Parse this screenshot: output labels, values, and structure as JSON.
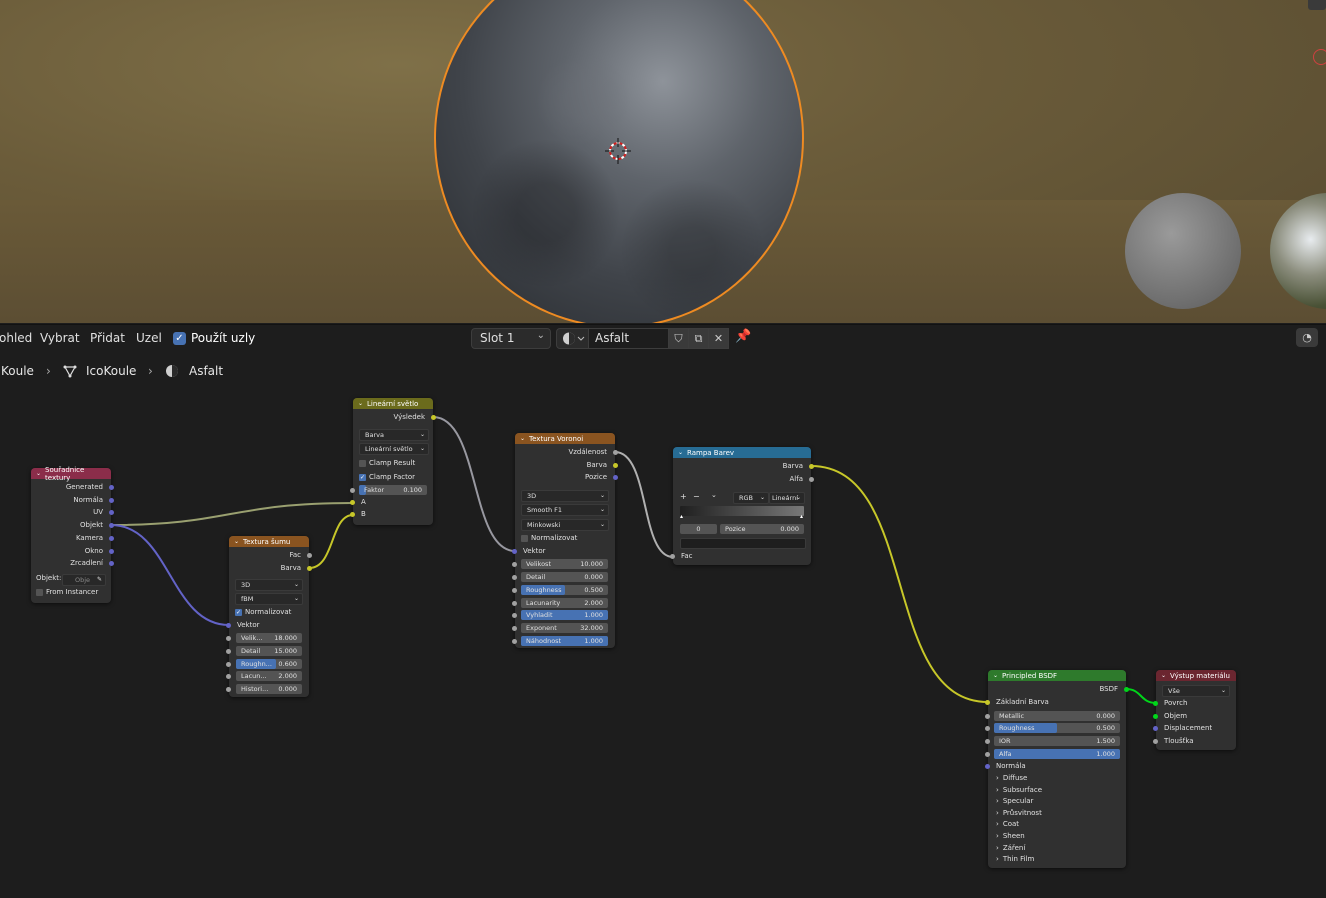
{
  "header": {
    "menu": [
      "ohled",
      "Vybrat",
      "Přidat",
      "Uzel"
    ],
    "use_nodes_label": "Použít uzly",
    "slot": "Slot 1",
    "material_name": "Asfalt"
  },
  "breadcrumb": [
    "Koule",
    "IcoKoule",
    "Asfalt"
  ],
  "nodes": {
    "tex_coord": {
      "title": "Souřadnice textury",
      "outputs": [
        "Generated",
        "Normála",
        "UV",
        "Objekt",
        "Kamera",
        "Okno",
        "Zrcadlení"
      ],
      "object_label": "Objekt:",
      "object_placeholder": "Obje",
      "from_instancer": "From Instancer"
    },
    "noise": {
      "title": "Textura šumu",
      "outputs": [
        "Fac",
        "Barva"
      ],
      "dim": "3D",
      "type": "fBM",
      "normalize": "Normalizovat",
      "vector": "Vektor",
      "fields": [
        {
          "k": "Velik...",
          "v": "18.000"
        },
        {
          "k": "Detail",
          "v": "15.000"
        },
        {
          "k": "Roughn...",
          "v": "0.600"
        },
        {
          "k": "Lacun...",
          "v": "2.000"
        },
        {
          "k": "Histori...",
          "v": "0.000"
        }
      ]
    },
    "linear_light": {
      "title": "Lineární světlo",
      "output": "Výsledek",
      "type": "Barva",
      "blend": "Lineární světlo",
      "clamp_result": "Clamp Result",
      "clamp_factor": "Clamp Factor",
      "factor_label": "Faktor",
      "factor_value": "0.100",
      "a": "A",
      "b": "B"
    },
    "voronoi": {
      "title": "Textura Voronoi",
      "outputs": [
        "Vzdálenost",
        "Barva",
        "Pozice"
      ],
      "dim": "3D",
      "feature": "Smooth F1",
      "metric": "Minkowski",
      "normalize": "Normalizovat",
      "vector": "Vektor",
      "fields": [
        {
          "k": "Velikost",
          "v": "10.000"
        },
        {
          "k": "Detail",
          "v": "0.000"
        },
        {
          "k": "Roughness",
          "v": "0.500"
        },
        {
          "k": "Lacunarity",
          "v": "2.000"
        },
        {
          "k": "Vyhladit",
          "v": "1.000"
        },
        {
          "k": "Exponent",
          "v": "32.000"
        },
        {
          "k": "Náhodnost",
          "v": "1.000"
        }
      ]
    },
    "ramp": {
      "title": "Rampa Barev",
      "outputs": [
        "Barva",
        "Alfa"
      ],
      "mode": "RGB",
      "interp": "Lineární",
      "index": "0",
      "pos_label": "Pozice",
      "pos_value": "0.000",
      "fac": "Fac"
    },
    "bsdf": {
      "title": "Principled BSDF",
      "output": "BSDF",
      "base_color": "Základní Barva",
      "fields": [
        {
          "k": "Metallic",
          "v": "0.000"
        },
        {
          "k": "Roughness",
          "v": "0.500"
        },
        {
          "k": "IOR",
          "v": "1.500"
        },
        {
          "k": "Alfa",
          "v": "1.000"
        }
      ],
      "normal": "Normála",
      "panels": [
        "Diffuse",
        "Subsurface",
        "Specular",
        "Průsvitnost",
        "Coat",
        "Sheen",
        "Záření",
        "Thin Film"
      ]
    },
    "output": {
      "title": "Výstup materiálu",
      "target": "Vše",
      "inputs": [
        "Povrch",
        "Objem",
        "Displacement",
        "Tloušťka"
      ]
    }
  },
  "colors": {
    "header_input": "#8b2d4a",
    "header_texture": "#8a5420",
    "header_color": "#6b6b1c",
    "header_converter": "#276c94",
    "header_shader": "#2e7a2c",
    "header_output": "#6b2630",
    "socket_yellow": "#c7c729",
    "socket_grey": "#a1a1a1",
    "socket_purple": "#6363c7",
    "socket_green": "#00d61a",
    "selection_orange": "#ee8b22"
  }
}
